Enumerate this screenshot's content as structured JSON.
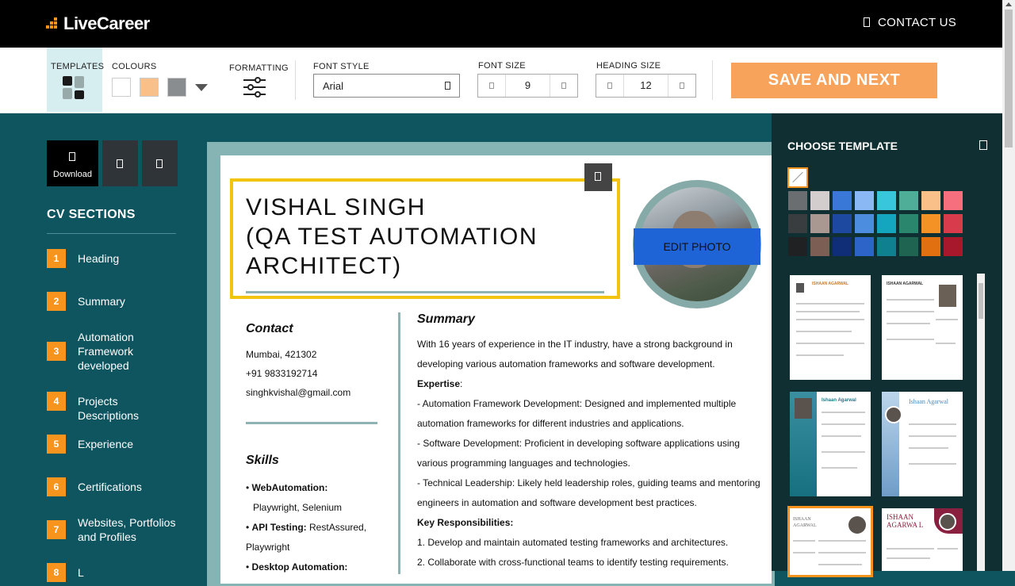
{
  "header": {
    "logo_text": "LiveCareer",
    "contact_label": "CONTACT US"
  },
  "toolbar": {
    "templates_label": "TEMPLATES",
    "colours_label": "COLOURS",
    "colours": [
      "#ffffff",
      "#f9c08a",
      "#8a8d90"
    ],
    "formatting_label": "FORMATTING",
    "font_style_label": "FONT STYLE",
    "font_style_value": "Arial",
    "font_size_label": "FONT SIZE",
    "font_size_value": "9",
    "heading_size_label": "HEADING SIZE",
    "heading_size_value": "12",
    "save_label": "SAVE AND NEXT"
  },
  "sidebar": {
    "download_label": "Download",
    "cv_sections_title": "CV SECTIONS",
    "sections": [
      {
        "num": "1",
        "label": "Heading"
      },
      {
        "num": "2",
        "label": "Summary"
      },
      {
        "num": "3",
        "label": "Automation Framework developed"
      },
      {
        "num": "4",
        "label": "Projects Descriptions"
      },
      {
        "num": "5",
        "label": "Experience"
      },
      {
        "num": "6",
        "label": "Certifications"
      },
      {
        "num": "7",
        "label": "Websites, Portfolios and Profiles"
      },
      {
        "num": "8",
        "label": "L"
      }
    ]
  },
  "resume": {
    "name": "VISHAL SINGH\n(QA TEST AUTOMATION\nARCHITECT)",
    "edit_photo_label": "EDIT PHOTO",
    "contact_heading": "Contact",
    "location": "Mumbai, 421302",
    "phone": "+91 9833192714",
    "email": "singhkvishal@gmail.com",
    "skills_heading": "Skills",
    "skills": [
      {
        "bold": "WebAutomation:",
        "rest": "Playwright, Selenium"
      },
      {
        "bold": "API Testing:",
        "rest": "RestAssured, Playwright"
      },
      {
        "bold": "Desktop Automation:",
        "rest": ""
      }
    ],
    "summary_heading": "Summary",
    "summary_lines": [
      "With 16 years of experience in the IT industry, have a strong background in developing various automation frameworks and software development."
    ],
    "expertise_label": "Expertise",
    "expertise_suffix": ":",
    "expertise_items": [
      "- Automation Framework Development: Designed and implemented multiple automation frameworks for different industries and applications.",
      "- Software Development: Proficient in developing software applications using various programming languages and technologies.",
      "- Technical Leadership: Likely held leadership roles, guiding teams and mentoring engineers in automation and software development best practices."
    ],
    "key_resp_label": "Key Responsibilities:",
    "key_resp_items": [
      "1. Develop and maintain automated testing frameworks and architectures.",
      "2. Collaborate with cross-functional teams to identify testing requirements."
    ]
  },
  "template_panel": {
    "title": "CHOOSE TEMPLATE",
    "color_rows": [
      [
        "#6b6e70",
        "#d4cdcd",
        "#3a78d8",
        "#8ab8f5",
        "#38c6dc",
        "#4eae98",
        "#f9c08a",
        "#f56f7e"
      ],
      [
        "#3a3d40",
        "#a99791",
        "#1d4aa0",
        "#4d8de0",
        "#14a6be",
        "#2a866c",
        "#f59225",
        "#d83b4c"
      ],
      [
        "#1f2123",
        "#7d5e55",
        "#102e78",
        "#2c64c8",
        "#0f8090",
        "#1e6450",
        "#e07010",
        "#a8182c"
      ]
    ],
    "thumb_names": [
      "ISHAAN AGARWAL",
      "ISHAAN AGARWAL",
      "Ishaan Agarwal",
      "Ishaan Agarwal",
      "ISHAAN AGARWAL",
      "ISHAAN AGARWA L"
    ]
  }
}
